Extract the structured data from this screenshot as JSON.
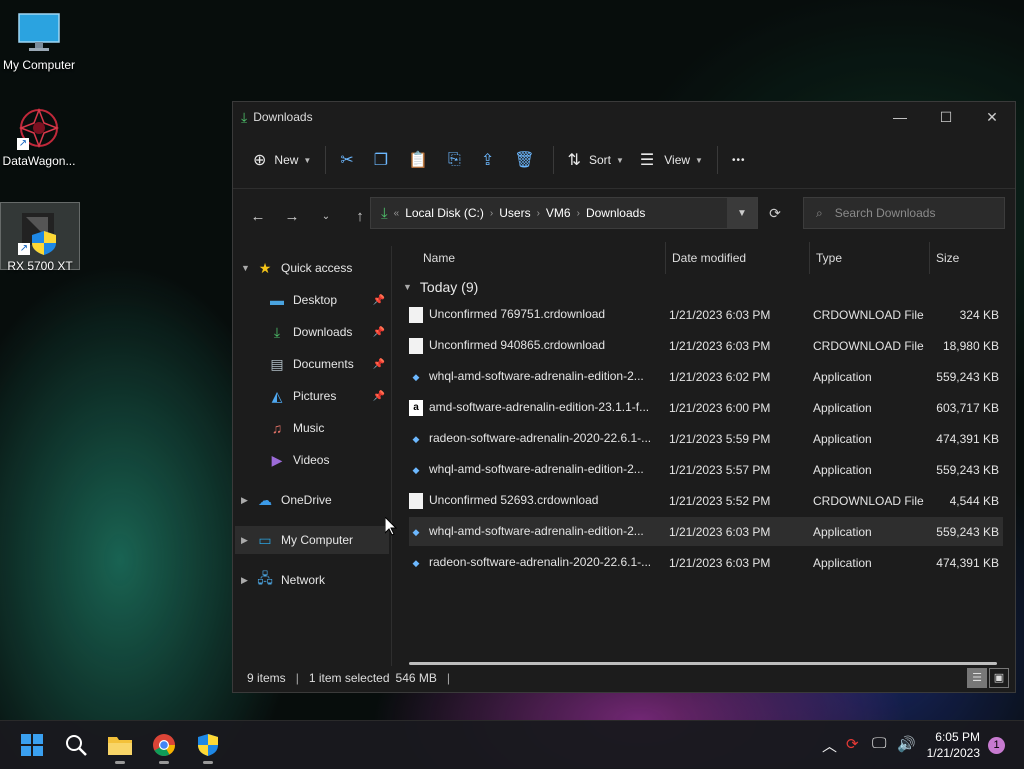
{
  "desktop": {
    "icons": [
      {
        "label": "My Computer",
        "icon": "monitor-icon"
      },
      {
        "label": "DataWagon...",
        "icon": "datawagon-logo-icon"
      },
      {
        "label": "RX 5700 XT",
        "icon": "amd-shield-icon"
      }
    ]
  },
  "window": {
    "title": "Downloads",
    "controls": {
      "minimize": "—",
      "maximize": "☐",
      "close": "✕"
    }
  },
  "toolbar": {
    "new_label": "New",
    "sort_label": "Sort",
    "view_label": "View",
    "more_label": "•••"
  },
  "address": {
    "crumbs": [
      "Local Disk (C:)",
      "Users",
      "VM6",
      "Downloads"
    ]
  },
  "search": {
    "placeholder": "Search Downloads"
  },
  "nav": {
    "quick_access": "Quick access",
    "items": [
      {
        "label": "Desktop",
        "pinned": true
      },
      {
        "label": "Downloads",
        "pinned": true
      },
      {
        "label": "Documents",
        "pinned": true
      },
      {
        "label": "Pictures",
        "pinned": true
      },
      {
        "label": "Music",
        "pinned": false
      },
      {
        "label": "Videos",
        "pinned": false
      }
    ],
    "onedrive": "OneDrive",
    "my_computer": "My Computer",
    "network": "Network"
  },
  "columns": {
    "name": "Name",
    "date": "Date modified",
    "type": "Type",
    "size": "Size"
  },
  "group": {
    "label": "Today (9)"
  },
  "files": [
    {
      "name": "Unconfirmed 769751.crdownload",
      "date": "1/21/2023 6:03 PM",
      "type": "CRDOWNLOAD File",
      "size": "324 KB",
      "icon": "doc"
    },
    {
      "name": "Unconfirmed 940865.crdownload",
      "date": "1/21/2023 6:03 PM",
      "type": "CRDOWNLOAD File",
      "size": "18,980 KB",
      "icon": "doc"
    },
    {
      "name": "whql-amd-software-adrenalin-edition-2...",
      "date": "1/21/2023 6:02 PM",
      "type": "Application",
      "size": "559,243 KB",
      "icon": "app"
    },
    {
      "name": "amd-software-adrenalin-edition-23.1.1-f...",
      "date": "1/21/2023 6:00 PM",
      "type": "Application",
      "size": "603,717 KB",
      "icon": "amd"
    },
    {
      "name": "radeon-software-adrenalin-2020-22.6.1-...",
      "date": "1/21/2023 5:59 PM",
      "type": "Application",
      "size": "474,391 KB",
      "icon": "app"
    },
    {
      "name": "whql-amd-software-adrenalin-edition-2...",
      "date": "1/21/2023 5:57 PM",
      "type": "Application",
      "size": "559,243 KB",
      "icon": "app"
    },
    {
      "name": "Unconfirmed 52693.crdownload",
      "date": "1/21/2023 5:52 PM",
      "type": "CRDOWNLOAD File",
      "size": "4,544 KB",
      "icon": "doc"
    },
    {
      "name": "whql-amd-software-adrenalin-edition-2...",
      "date": "1/21/2023 6:03 PM",
      "type": "Application",
      "size": "559,243 KB",
      "icon": "app",
      "selected": true
    },
    {
      "name": "radeon-software-adrenalin-2020-22.6.1-...",
      "date": "1/21/2023 6:03 PM",
      "type": "Application",
      "size": "474,391 KB",
      "icon": "app"
    }
  ],
  "status": {
    "items": "9 items",
    "selected": "1 item selected",
    "size": "546 MB",
    "trailing": "|"
  },
  "taskbar": {
    "clock_time": "6:05 PM",
    "clock_date": "1/21/2023",
    "notifications": "1"
  },
  "colors": {
    "accent": "#6cb8ff",
    "download_green": "#4ec26b",
    "window_bg": "#1c1c1c"
  }
}
